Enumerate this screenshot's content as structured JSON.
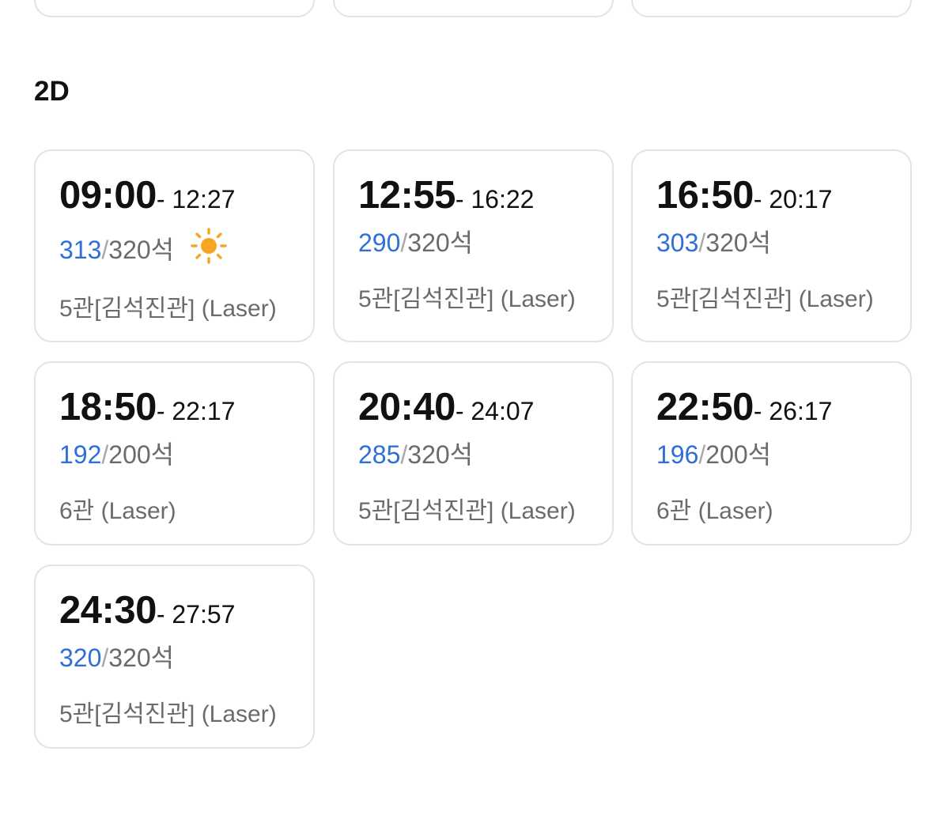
{
  "section_title": "2D",
  "seat_suffix": "석",
  "sun_icon": "sun-icon",
  "colors": {
    "available": "#2e6fd8",
    "text": "#111111",
    "muted": "#6b6b6b",
    "border": "#e3e3e3"
  },
  "showtimes": [
    {
      "start": "09:00",
      "end": "- 12:27",
      "available": "313",
      "total": "320석",
      "hall": "5관[김석진관] (Laser)",
      "morning": true
    },
    {
      "start": "12:55",
      "end": "- 16:22",
      "available": "290",
      "total": "320석",
      "hall": "5관[김석진관] (Laser)",
      "morning": false
    },
    {
      "start": "16:50",
      "end": "- 20:17",
      "available": "303",
      "total": "320석",
      "hall": "5관[김석진관] (Laser)",
      "morning": false
    },
    {
      "start": "18:50",
      "end": "- 22:17",
      "available": "192",
      "total": "200석",
      "hall": "6관 (Laser)",
      "morning": false
    },
    {
      "start": "20:40",
      "end": "- 24:07",
      "available": "285",
      "total": "320석",
      "hall": "5관[김석진관] (Laser)",
      "morning": false
    },
    {
      "start": "22:50",
      "end": "- 26:17",
      "available": "196",
      "total": "200석",
      "hall": "6관 (Laser)",
      "morning": false
    },
    {
      "start": "24:30",
      "end": "- 27:57",
      "available": "320",
      "total": "320석",
      "hall": "5관[김석진관] (Laser)",
      "morning": false
    }
  ]
}
